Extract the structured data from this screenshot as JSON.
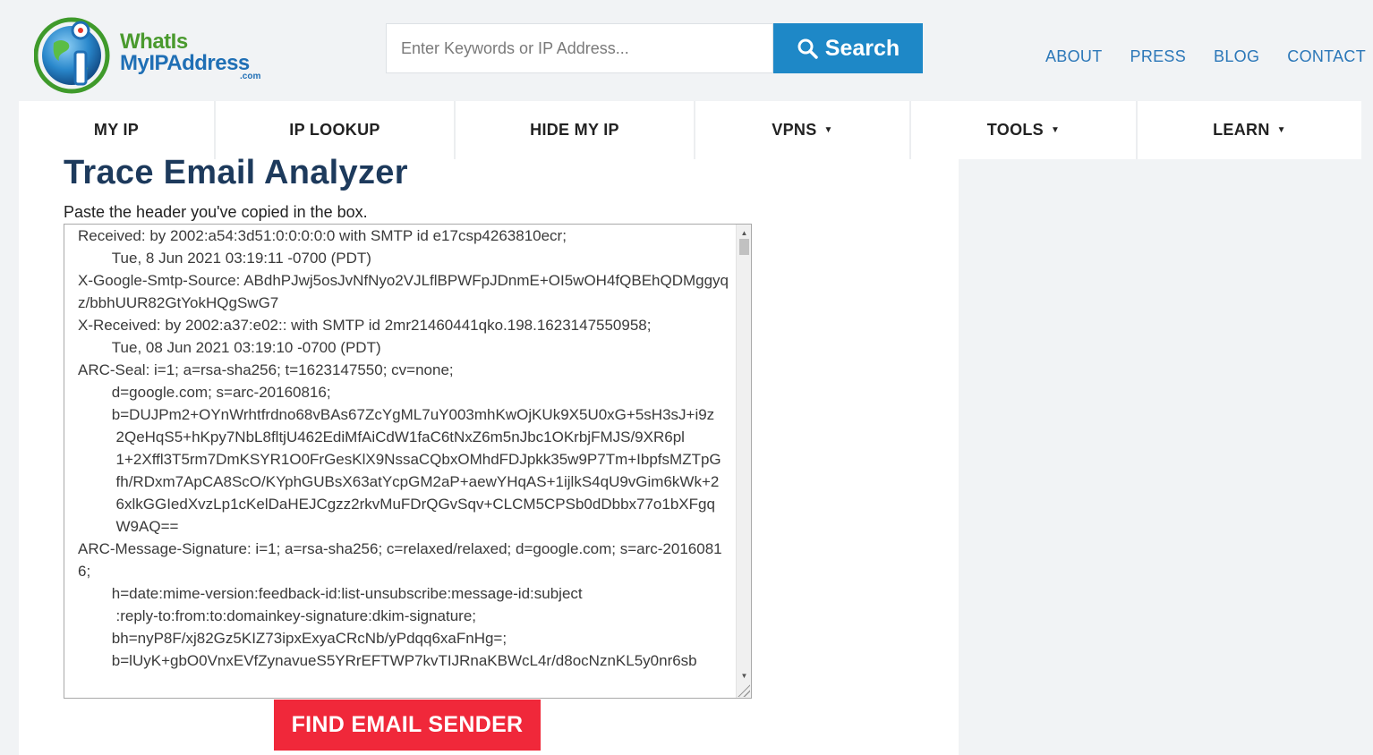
{
  "logo": {
    "line1": "WhatIs",
    "line2": "MyIPAddress",
    "suffix": ".com"
  },
  "search": {
    "placeholder": "Enter Keywords or IP Address...",
    "button_label": "Search"
  },
  "top_links": [
    "ABOUT",
    "PRESS",
    "BLOG",
    "CONTACT"
  ],
  "nav": [
    {
      "label": "MY IP",
      "dropdown": false
    },
    {
      "label": "IP LOOKUP",
      "dropdown": false
    },
    {
      "label": "HIDE MY IP",
      "dropdown": false
    },
    {
      "label": "VPNS",
      "dropdown": true
    },
    {
      "label": "TOOLS",
      "dropdown": true
    },
    {
      "label": "LEARN",
      "dropdown": true
    }
  ],
  "main": {
    "title": "Trace Email Analyzer",
    "instructions": "Paste the header you've copied in the box.",
    "header_lines": [
      "Received: by 2002:a54:3d51:0:0:0:0:0 with SMTP id e17csp4263810ecr;",
      "        Tue, 8 Jun 2021 03:19:11 -0700 (PDT)",
      "X-Google-Smtp-Source: ABdhPJwj5osJvNfNyo2VJLflBPWFpJDnmE+OI5wOH4fQBEhQDMggyqz/bbhUUR82GtYokHQgSwG7",
      "X-Received: by 2002:a37:e02:: with SMTP id 2mr21460441qko.198.1623147550958;",
      "        Tue, 08 Jun 2021 03:19:10 -0700 (PDT)",
      "ARC-Seal: i=1; a=rsa-sha256; t=1623147550; cv=none;",
      "        d=google.com; s=arc-20160816;",
      "        b=DUJPm2+OYnWrhtfrdno68vBAs67ZcYgML7uY003mhKwOjKUk9X5U0xG+5sH3sJ+i9z",
      "         2QeHqS5+hKpy7NbL8fltjU462EdiMfAiCdW1faC6tNxZ6m5nJbc1OKrbjFMJS/9XR6pl",
      "         1+2Xffl3T5rm7DmKSYR1O0FrGesKlX9NssaCQbxOMhdFDJpkk35w9P7Tm+IbpfsMZTpG",
      "         fh/RDxm7ApCA8ScO/KYphGUBsX63atYcpGM2aP+aewYHqAS+1ijlkS4qU9vGim6kWk+2",
      "         6xlkGGIedXvzLp1cKelDaHEJCgzz2rkvMuFDrQGvSqv+CLCM5CPSb0dDbbx77o1bXFgq",
      "         W9AQ==",
      "ARC-Message-Signature: i=1; a=rsa-sha256; c=relaxed/relaxed; d=google.com; s=arc-20160816;",
      "        h=date:mime-version:feedback-id:list-unsubscribe:message-id:subject",
      "         :reply-to:from:to:domainkey-signature:dkim-signature;",
      "        bh=nyP8F/xj82Gz5KIZ73ipxExyaCRcNb/yPdqq6xaFnHg=;",
      "        b=lUyK+gbO0VnxEVfZynavueS5YRrEFTWP7kvTIJRnaKBWcL4r/d8ocNznKL5y0nr6sb"
    ],
    "submit_label": "FIND EMAIL SENDER"
  },
  "colors": {
    "brand_blue": "#1e88c7",
    "title_navy": "#1d3a5c",
    "submit_red": "#f0283a",
    "link_blue": "#2b77b8",
    "logo_green": "#4a9a2e"
  }
}
